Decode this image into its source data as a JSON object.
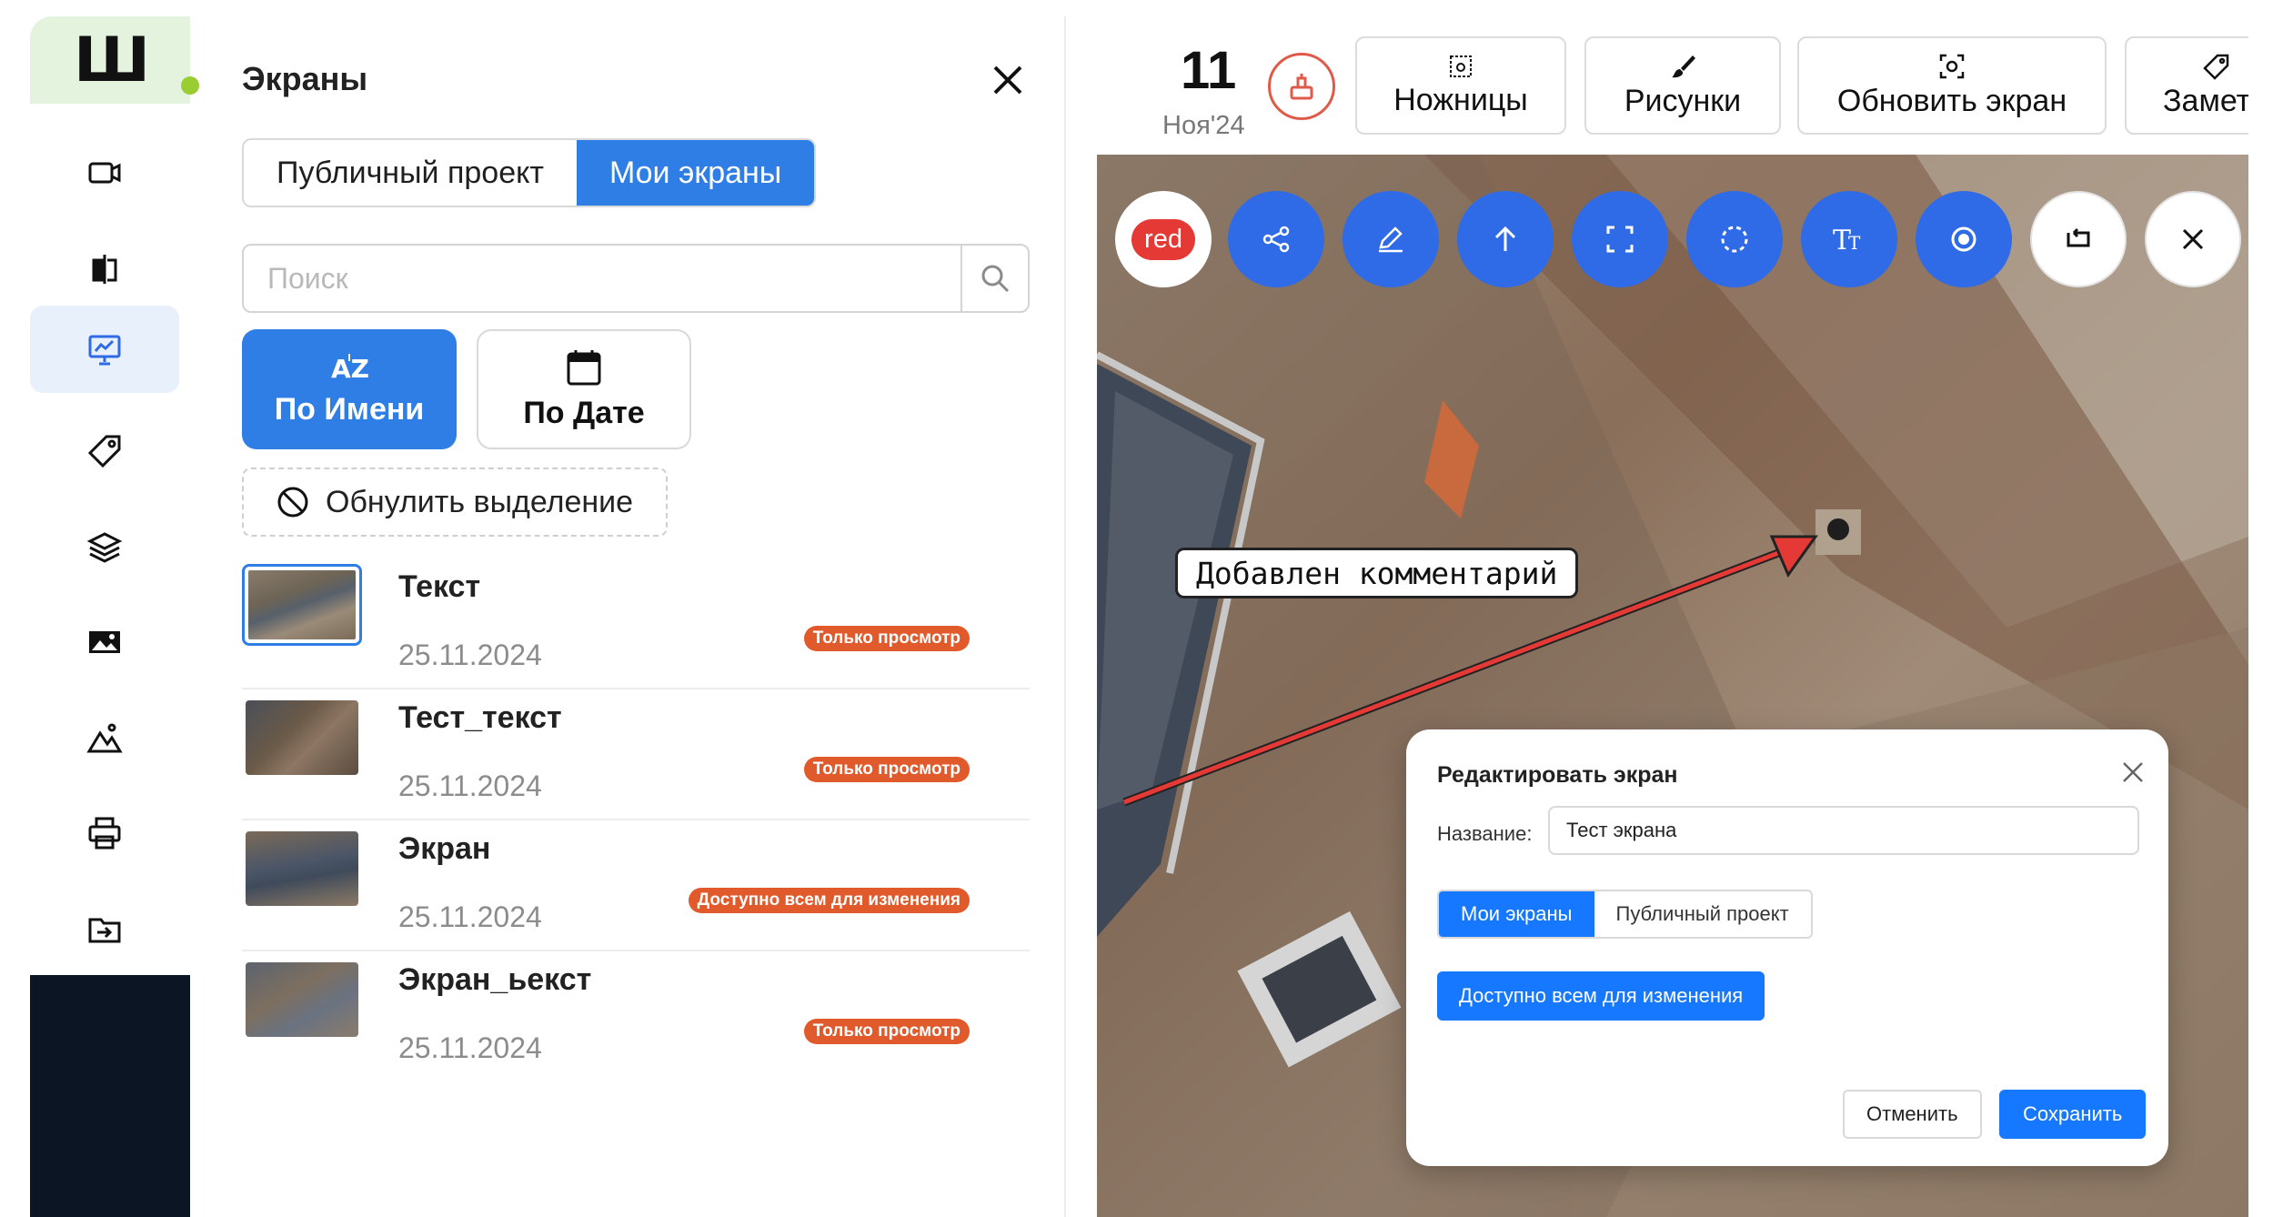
{
  "logo": {
    "text": "Ш"
  },
  "rail": {
    "items": [
      {
        "icon": "video-camera-icon"
      },
      {
        "icon": "compare-icon"
      },
      {
        "icon": "presentation-icon",
        "active": true
      },
      {
        "icon": "tag-icon"
      },
      {
        "icon": "layers-icon"
      },
      {
        "icon": "image-icon"
      },
      {
        "icon": "mountains-icon"
      },
      {
        "icon": "printer-icon"
      },
      {
        "icon": "folder-import-icon"
      }
    ]
  },
  "panel": {
    "title": "Экраны",
    "tabs": {
      "public": "Публичный проект",
      "mine": "Мои экраны",
      "active": "mine"
    },
    "search": {
      "placeholder": "Поиск",
      "value": ""
    },
    "sort": {
      "by_name": "По Имени",
      "by_date": "По Дате",
      "active": "by_name"
    },
    "reset_label": "Обнулить выделение",
    "items": [
      {
        "title": "Текст",
        "date": "25.11.2024",
        "badge": "Только просмотр",
        "selected": true
      },
      {
        "title": "Тест_текст",
        "date": "25.11.2024",
        "badge": "Только просмотр"
      },
      {
        "title": "Экран",
        "date": "25.11.2024",
        "badge": "Доступно всем для изменения"
      },
      {
        "title": "Экран_ьекст",
        "date": "25.11.2024",
        "badge": "Только просмотр"
      }
    ]
  },
  "viewer": {
    "date": {
      "day": "11",
      "month": "Ноя'24"
    },
    "toolbar": {
      "scissors": "Ножницы",
      "drawings": "Рисунки",
      "refresh": "Обновить экран",
      "notes": "Замет"
    },
    "draw_tools": {
      "color_label": "red",
      "color": "#e53935",
      "icons": [
        "share-icon",
        "pencil-icon",
        "arrow-up-icon",
        "fullscreen-icon",
        "lasso-circle-icon",
        "text-icon",
        "record-icon",
        "undo-icon",
        "close-icon"
      ]
    },
    "comment": "Добавлен комментарий"
  },
  "dialog": {
    "title": "Редактировать экран",
    "name_label": "Название:",
    "name_value": "Тест экрана",
    "tabs": {
      "mine": "Мои экраны",
      "public": "Публичный проект",
      "active": "mine"
    },
    "access_button": "Доступно всем для изменения",
    "cancel": "Отменить",
    "save": "Сохранить"
  },
  "colors": {
    "accent": "#2f7ee6",
    "badge": "#e05a2b",
    "rail_dark": "#0b1524",
    "logo_bg": "#e4f3de"
  }
}
